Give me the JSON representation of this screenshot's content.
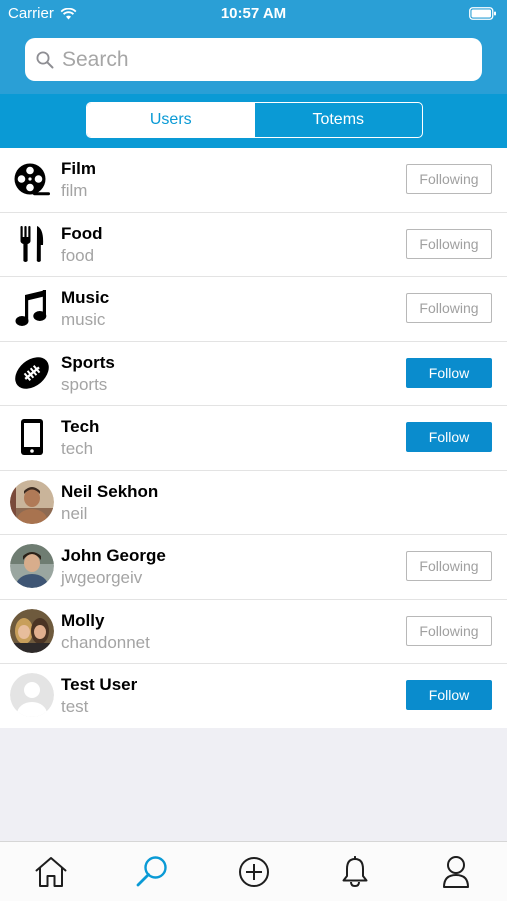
{
  "status_bar": {
    "carrier": "Carrier",
    "time": "10:57 AM"
  },
  "search": {
    "placeholder": "Search"
  },
  "segments": {
    "users": "Users",
    "totems": "Totems"
  },
  "rows": [
    {
      "title": "Film",
      "subtitle": "film",
      "icon": "film-reel-icon",
      "button": "Following"
    },
    {
      "title": "Food",
      "subtitle": "food",
      "icon": "fork-knife-icon",
      "button": "Following"
    },
    {
      "title": "Music",
      "subtitle": "music",
      "icon": "music-note-icon",
      "button": "Following"
    },
    {
      "title": "Sports",
      "subtitle": "sports",
      "icon": "football-icon",
      "button": "Follow"
    },
    {
      "title": "Tech",
      "subtitle": "tech",
      "icon": "phone-icon",
      "button": "Follow"
    },
    {
      "title": "Neil Sekhon",
      "subtitle": "neil",
      "icon": "avatar",
      "button": ""
    },
    {
      "title": "John George",
      "subtitle": "jwgeorgeiv",
      "icon": "avatar",
      "button": "Following"
    },
    {
      "title": "Molly",
      "subtitle": "chandonnet",
      "icon": "avatar",
      "button": "Following"
    },
    {
      "title": "Test User",
      "subtitle": "test",
      "icon": "default-avatar",
      "button": "Follow"
    }
  ],
  "tabbar": [
    "home-icon",
    "search-icon",
    "add-icon",
    "bell-icon",
    "profile-icon"
  ],
  "colors": {
    "header": "#2a9fd6",
    "segment_bar": "#0a9ad5",
    "follow_button": "#0a8ccd",
    "active_tab": "#0a9ad5"
  }
}
